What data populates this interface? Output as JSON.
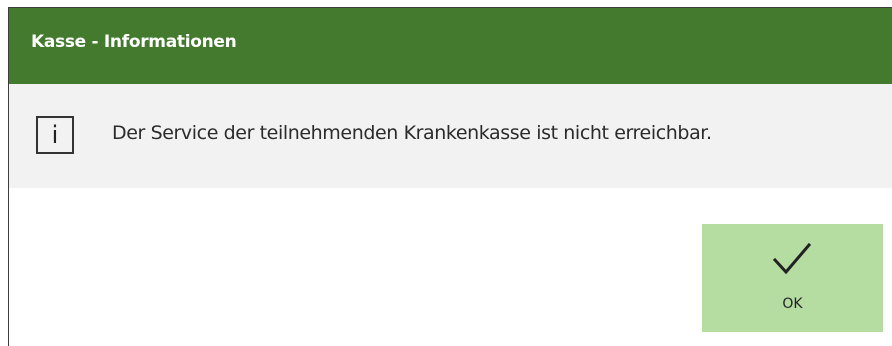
{
  "dialog": {
    "title": "Kasse - Informationen",
    "icon": "info-icon",
    "icon_glyph": "i",
    "message": "Der Service der teilnehmenden Krankenkasse ist nicht erreichbar.",
    "ok_button": {
      "icon": "checkmark-icon",
      "label": "OK"
    }
  },
  "colors": {
    "titlebar": "#437a2e",
    "message_background": "#f2f2f2",
    "ok_button": "#b5dca1"
  }
}
